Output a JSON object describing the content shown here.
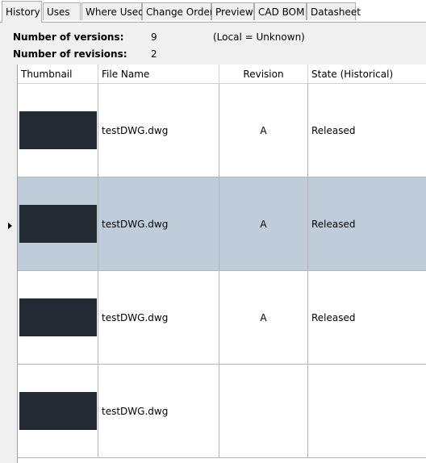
{
  "tabs": [
    {
      "label": "History",
      "active": true
    },
    {
      "label": "Uses",
      "active": false
    },
    {
      "label": "Where Used",
      "active": false
    },
    {
      "label": "Change Order",
      "active": false
    },
    {
      "label": "Preview",
      "active": false
    },
    {
      "label": "CAD BOM",
      "active": false
    },
    {
      "label": "Datasheet",
      "active": false
    }
  ],
  "summary": {
    "versions_label": "Number of versions:",
    "versions_value": "9",
    "versions_note": "(Local = Unknown)",
    "revisions_label": "Number of revisions:",
    "revisions_value": "2"
  },
  "columns": {
    "thumbnail": "Thumbnail",
    "file_name": "File Name",
    "revision": "Revision",
    "state": "State (Historical)"
  },
  "rows": [
    {
      "file_name": "testDWG.dwg",
      "revision": "A",
      "state": "Released",
      "selected": false
    },
    {
      "file_name": "testDWG.dwg",
      "revision": "A",
      "state": "Released",
      "selected": true
    },
    {
      "file_name": "testDWG.dwg",
      "revision": "A",
      "state": "Released",
      "selected": false
    },
    {
      "file_name": "testDWG.dwg",
      "revision": "",
      "state": "",
      "selected": false
    }
  ],
  "colors": {
    "selected_row": "#bfcdda",
    "thumbnail_fill": "#222a33",
    "panel_bg": "#f0f0f0"
  }
}
